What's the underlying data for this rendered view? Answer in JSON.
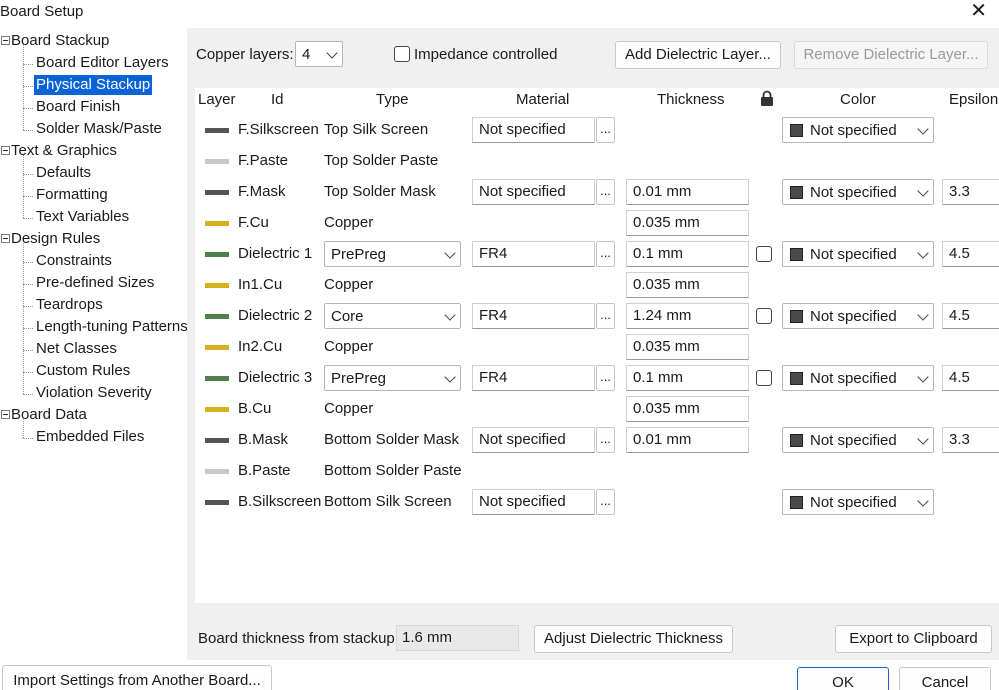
{
  "window": {
    "title": "Board Setup"
  },
  "tree": [
    {
      "label": "Board Stackup",
      "kind": "parent"
    },
    {
      "label": "Board Editor Layers",
      "kind": "child"
    },
    {
      "label": "Physical Stackup",
      "kind": "child",
      "selected": true
    },
    {
      "label": "Board Finish",
      "kind": "child"
    },
    {
      "label": "Solder Mask/Paste",
      "kind": "child"
    },
    {
      "label": "Text & Graphics",
      "kind": "parent"
    },
    {
      "label": "Defaults",
      "kind": "child"
    },
    {
      "label": "Formatting",
      "kind": "child"
    },
    {
      "label": "Text Variables",
      "kind": "child"
    },
    {
      "label": "Design Rules",
      "kind": "parent"
    },
    {
      "label": "Constraints",
      "kind": "child"
    },
    {
      "label": "Pre-defined Sizes",
      "kind": "child"
    },
    {
      "label": "Teardrops",
      "kind": "child"
    },
    {
      "label": "Length-tuning Patterns",
      "kind": "child"
    },
    {
      "label": "Net Classes",
      "kind": "child"
    },
    {
      "label": "Custom Rules",
      "kind": "child"
    },
    {
      "label": "Violation Severity",
      "kind": "child"
    },
    {
      "label": "Board Data",
      "kind": "parent"
    },
    {
      "label": "Embedded Files",
      "kind": "child"
    }
  ],
  "toolbar": {
    "copper_layers_label": "Copper layers:",
    "copper_layers_value": "4",
    "impedance_label": "Impedance controlled",
    "add_dielectric": "Add Dielectric Layer...",
    "remove_dielectric": "Remove Dielectric Layer..."
  },
  "columns": {
    "layer": "Layer",
    "id": "Id",
    "type": "Type",
    "material": "Material",
    "thickness": "Thickness",
    "color": "Color",
    "epsilon": "Epsilon"
  },
  "rows": [
    {
      "id": "F.Silkscreen",
      "swatch": "#555555",
      "type": "Top Silk Screen",
      "type_combo": false,
      "material": "Not specified",
      "thickness": "",
      "lock": false,
      "color": "Not specified",
      "epsilon": ""
    },
    {
      "id": "F.Paste",
      "swatch": "#c8c8c8",
      "type": "Top Solder Paste",
      "type_combo": false,
      "material": "",
      "thickness": "",
      "lock": false,
      "color": "",
      "epsilon": ""
    },
    {
      "id": "F.Mask",
      "swatch": "#555555",
      "type": "Top Solder Mask",
      "type_combo": false,
      "material": "Not specified",
      "thickness": "0.01 mm",
      "lock": false,
      "color": "Not specified",
      "epsilon": "3.3"
    },
    {
      "id": "F.Cu",
      "swatch": "#d4b11e",
      "type": "Copper",
      "type_combo": false,
      "material": "",
      "thickness": "0.035 mm",
      "lock": false,
      "color": "",
      "epsilon": ""
    },
    {
      "id": "Dielectric 1",
      "swatch": "#4e7f4c",
      "type": "PrePreg",
      "type_combo": true,
      "material": "FR4",
      "thickness": "0.1 mm",
      "lock": true,
      "color": "Not specified",
      "epsilon": "4.5"
    },
    {
      "id": "In1.Cu",
      "swatch": "#d4b11e",
      "type": "Copper",
      "type_combo": false,
      "material": "",
      "thickness": "0.035 mm",
      "lock": false,
      "color": "",
      "epsilon": ""
    },
    {
      "id": "Dielectric 2",
      "swatch": "#4e7f4c",
      "type": "Core",
      "type_combo": true,
      "material": "FR4",
      "thickness": "1.24 mm",
      "lock": true,
      "color": "Not specified",
      "epsilon": "4.5"
    },
    {
      "id": "In2.Cu",
      "swatch": "#d4b11e",
      "type": "Copper",
      "type_combo": false,
      "material": "",
      "thickness": "0.035 mm",
      "lock": false,
      "color": "",
      "epsilon": ""
    },
    {
      "id": "Dielectric 3",
      "swatch": "#4e7f4c",
      "type": "PrePreg",
      "type_combo": true,
      "material": "FR4",
      "thickness": "0.1 mm",
      "lock": true,
      "color": "Not specified",
      "epsilon": "4.5"
    },
    {
      "id": "B.Cu",
      "swatch": "#d4b11e",
      "type": "Copper",
      "type_combo": false,
      "material": "",
      "thickness": "0.035 mm",
      "lock": false,
      "color": "",
      "epsilon": ""
    },
    {
      "id": "B.Mask",
      "swatch": "#555555",
      "type": "Bottom Solder Mask",
      "type_combo": false,
      "material": "Not specified",
      "thickness": "0.01 mm",
      "lock": false,
      "color": "Not specified",
      "epsilon": "3.3"
    },
    {
      "id": "B.Paste",
      "swatch": "#c8c8c8",
      "type": "Bottom Solder Paste",
      "type_combo": false,
      "material": "",
      "thickness": "",
      "lock": false,
      "color": "",
      "epsilon": ""
    },
    {
      "id": "B.Silkscreen",
      "swatch": "#555555",
      "type": "Bottom Silk Screen",
      "type_combo": false,
      "material": "Not specified",
      "thickness": "",
      "lock": false,
      "color": "Not specified",
      "epsilon": ""
    }
  ],
  "footer": {
    "board_thickness_label": "Board thickness from stackup:",
    "board_thickness_value": "1.6 mm",
    "adjust_button": "Adjust Dielectric Thickness",
    "export_button": "Export to Clipboard"
  },
  "bottom": {
    "import_button": "Import Settings from Another Board...",
    "ok": "OK",
    "cancel": "Cancel"
  },
  "icons": {
    "close": "close-icon",
    "lock": "lock-icon",
    "chevron": "chevron-down-icon",
    "expander": "tree-expander-icon"
  }
}
